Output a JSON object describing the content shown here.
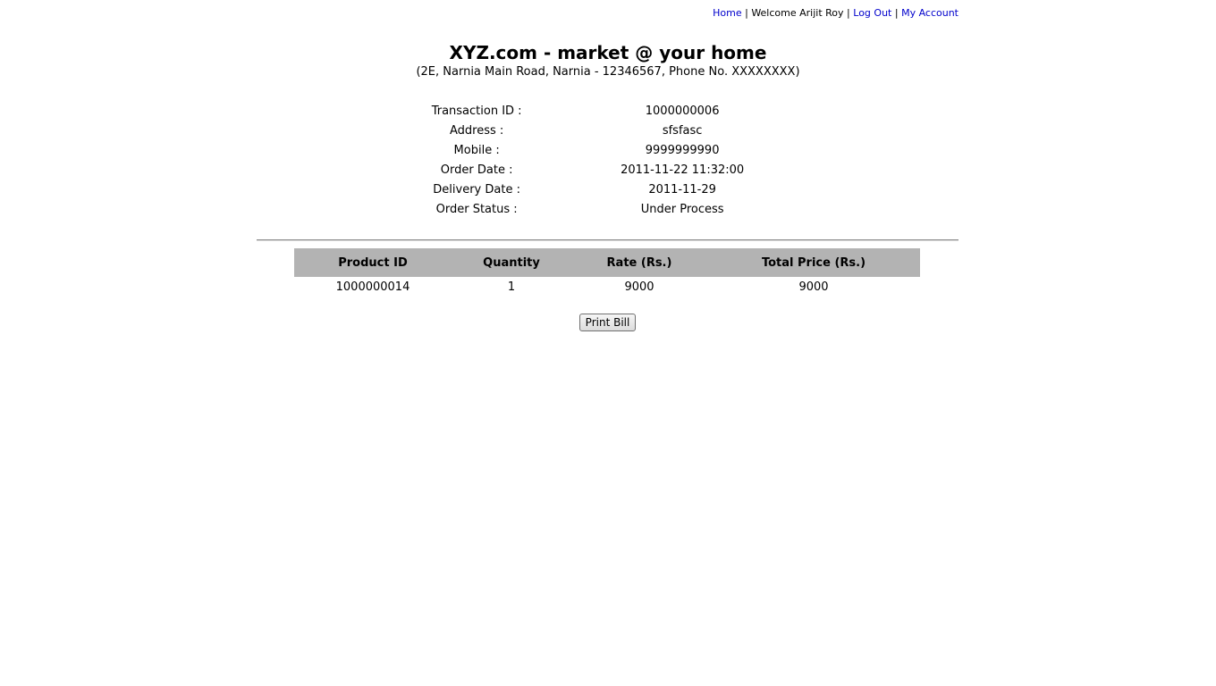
{
  "nav": {
    "home": "Home",
    "separator": "|",
    "welcome": "Welcome Arijit Roy",
    "logout": "Log Out",
    "account": "My Account"
  },
  "header": {
    "title": "XYZ.com - market @ your home",
    "address": "(2E, Narnia Main Road, Narnia - 12346567, Phone No. XXXXXXXX)"
  },
  "order": {
    "rows": [
      {
        "label": "Transaction ID :",
        "value": "1000000006"
      },
      {
        "label": "Address :",
        "value": "sfsfasc"
      },
      {
        "label": "Mobile :",
        "value": "9999999990"
      },
      {
        "label": "Order Date :",
        "value": "2011-11-22 11:32:00"
      },
      {
        "label": "Delivery Date :",
        "value": "2011-11-29"
      },
      {
        "label": "Order Status :",
        "value": "Under Process"
      }
    ]
  },
  "items": {
    "headers": [
      "Product ID",
      "Quantity",
      "Rate (Rs.)",
      "Total Price (Rs.)"
    ],
    "rows": [
      [
        "1000000014",
        "1",
        "9000",
        "9000"
      ]
    ]
  },
  "actions": {
    "print_label": "Print Bill"
  },
  "colors": {
    "link": "#0000cc",
    "table_header_bg": "#b3b3b3"
  }
}
